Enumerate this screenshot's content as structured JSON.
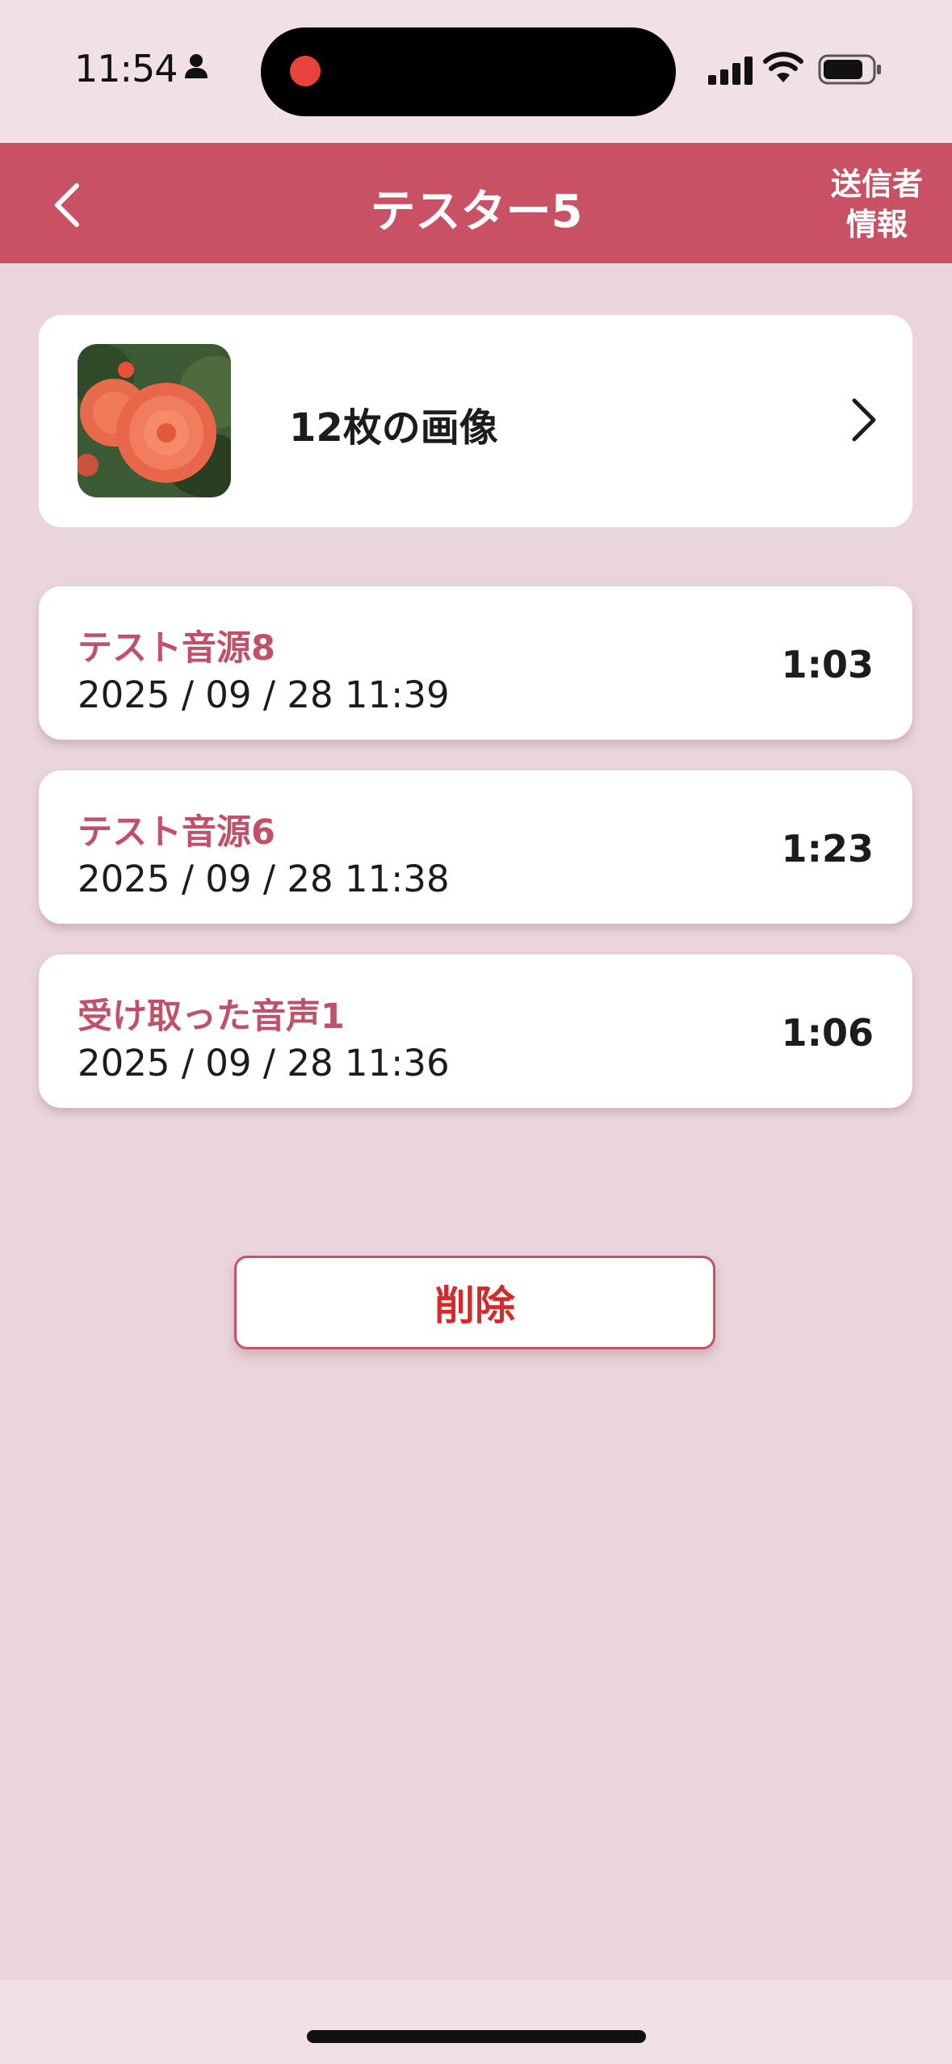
{
  "status_bar": {
    "time": "11:54",
    "icons": [
      "person-icon",
      "recording-dot-icon",
      "signal-bars-icon",
      "wifi-icon",
      "battery-icon"
    ]
  },
  "nav": {
    "back_icon": "chevron-left-icon",
    "title": "テスター5",
    "sender_info_line1": "送信者",
    "sender_info_line2": "情報"
  },
  "images_card": {
    "label": "12枚の画像",
    "thumbnail_icon": "flower-photo-thumbnail",
    "chevron_icon": "chevron-right-icon"
  },
  "audio_list": [
    {
      "title": "テスト音源8",
      "date": "2025 / 09 / 28  11:39",
      "duration": "1:03"
    },
    {
      "title": "テスト音源6",
      "date": "2025 / 09 / 28  11:38",
      "duration": "1:23"
    },
    {
      "title": "受け取った音声1",
      "date": "2025 / 09 / 28  11:36",
      "duration": "1:06"
    }
  ],
  "delete_button": {
    "label": "削除"
  },
  "colors": {
    "accent": "#c85163",
    "background": "#ead5dc",
    "audio_title": "#c0516a",
    "delete_text": "#d42a2a"
  }
}
